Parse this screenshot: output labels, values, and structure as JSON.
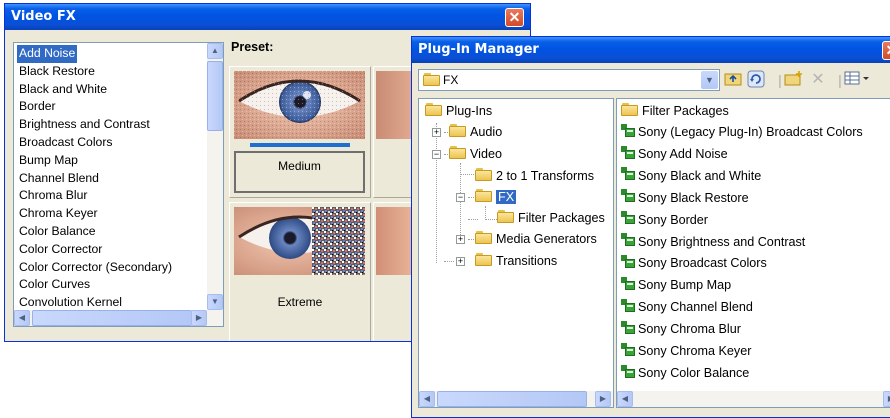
{
  "video_fx": {
    "title": "Video FX",
    "close_symbol": "✕",
    "effects": [
      "Add Noise",
      "Black Restore",
      "Black and White",
      "Border",
      "Brightness and Contrast",
      "Broadcast Colors",
      "Bump Map",
      "Channel Blend",
      "Chroma Blur",
      "Chroma Keyer",
      "Color Balance",
      "Color Corrector",
      "Color Corrector (Secondary)",
      "Color Curves",
      "Convolution Kernel"
    ],
    "selected_effect": "Add Noise",
    "preset_label": "Preset:",
    "presets": [
      {
        "caption": "Medium",
        "selected": true,
        "noise": "medium"
      },
      {
        "caption": "Extreme",
        "selected": false,
        "noise": "extreme"
      }
    ]
  },
  "plugin_manager": {
    "title": "Plug-In Manager",
    "address_value": "FX",
    "toolbar_icons": [
      "up-folder-icon",
      "refresh-icon",
      "new-folder-icon",
      "delete-icon",
      "view-menu-icon"
    ],
    "tree": {
      "root": "Plug-Ins",
      "audio": "Audio",
      "video": "Video",
      "transforms": "2 to 1 Transforms",
      "fx": "FX",
      "filter_packages": "Filter Packages",
      "media_generators": "Media Generators",
      "transitions": "Transitions"
    },
    "list": {
      "folder": "Filter Packages",
      "plugins": [
        "Sony (Legacy Plug-In) Broadcast Colors",
        "Sony Add Noise",
        "Sony Black and White",
        "Sony Black Restore",
        "Sony Border",
        "Sony Brightness and Contrast",
        "Sony Broadcast Colors",
        "Sony Bump Map",
        "Sony Channel Blend",
        "Sony Chroma Blur",
        "Sony Chroma Keyer",
        "Sony Color Balance"
      ]
    }
  }
}
